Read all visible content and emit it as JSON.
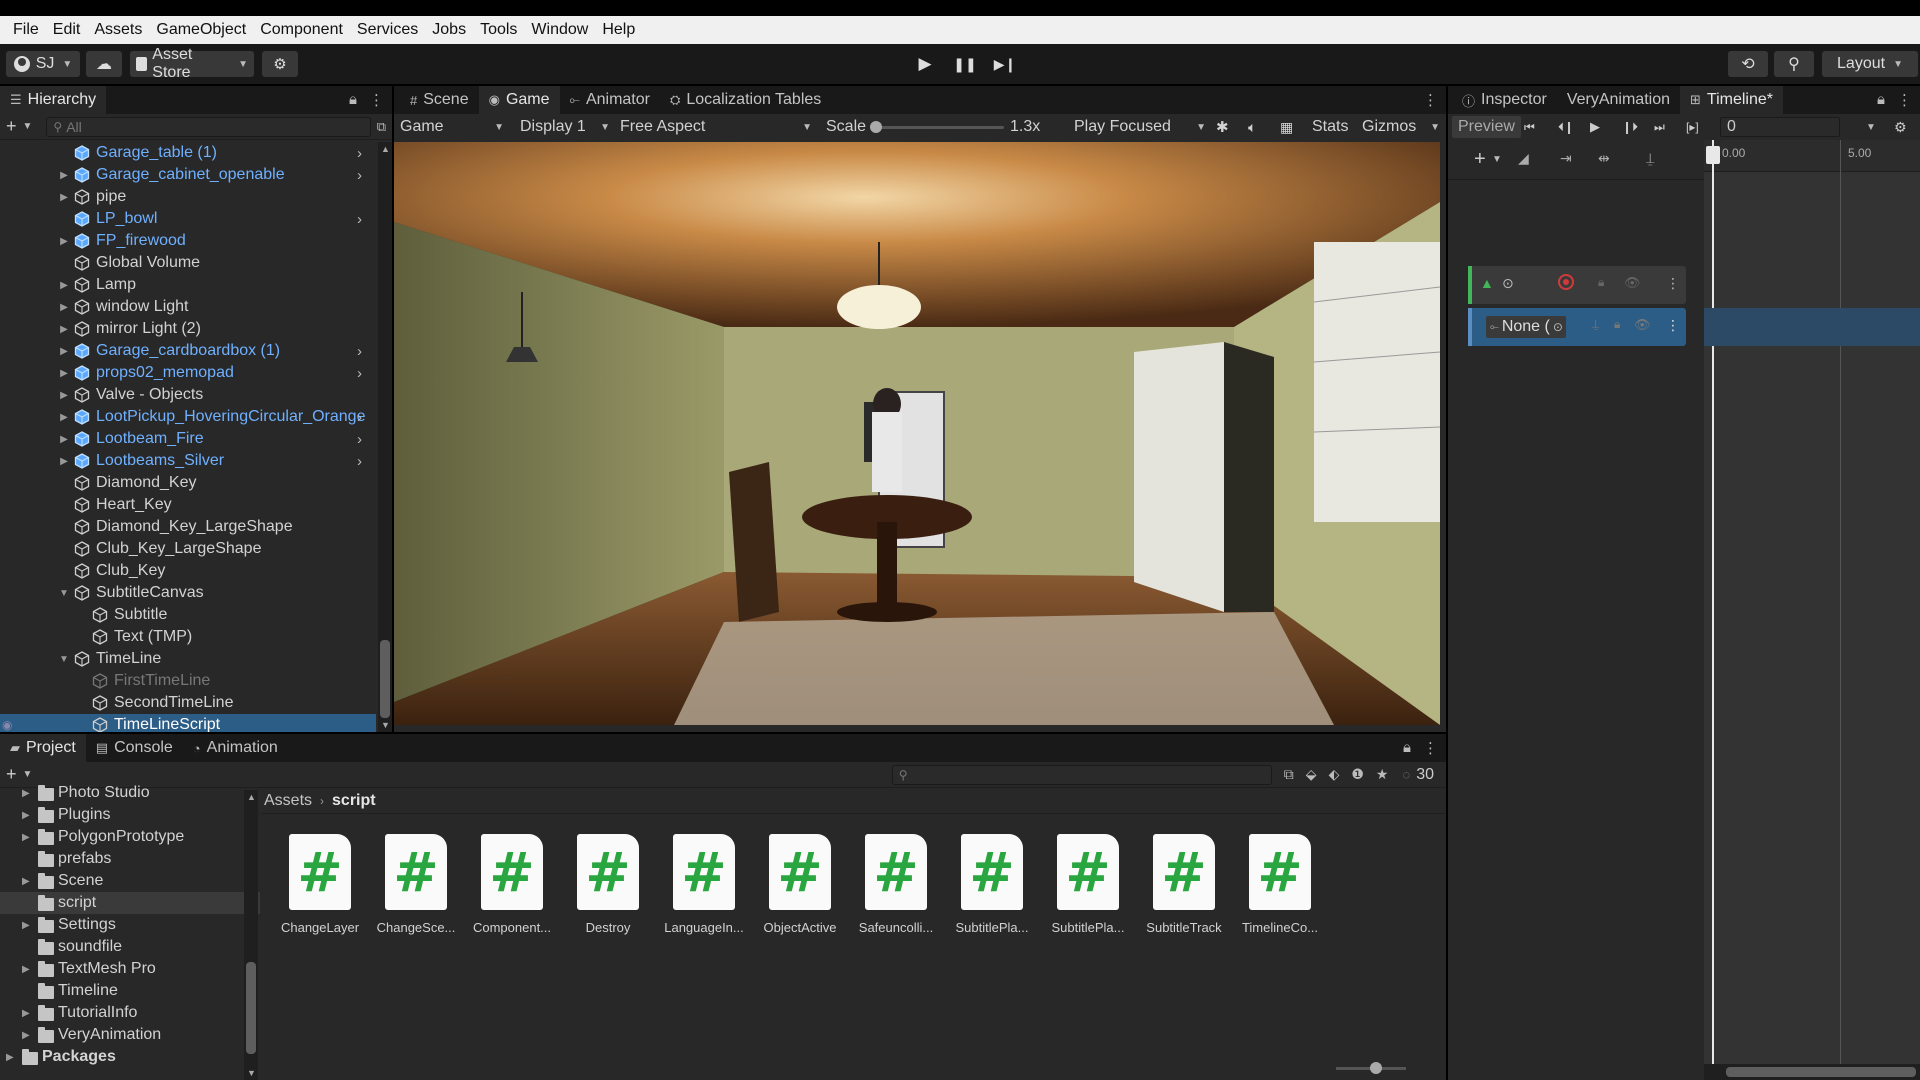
{
  "menu": [
    "File",
    "Edit",
    "Assets",
    "GameObject",
    "Component",
    "Services",
    "Jobs",
    "Tools",
    "Window",
    "Help"
  ],
  "toolbar": {
    "account": "SJ",
    "asset_store": "Asset Store",
    "layout": "Layout"
  },
  "hierarchy": {
    "tab": "Hierarchy",
    "search_placeholder": "All",
    "items": [
      {
        "label": "Garage_table (1)",
        "prefab": true,
        "fold": "none",
        "arrow": true
      },
      {
        "label": "Garage_cabinet_openable",
        "prefab": true,
        "fold": "closed",
        "arrow": true
      },
      {
        "label": "pipe",
        "prefab": false,
        "fold": "closed",
        "arrow": false
      },
      {
        "label": "LP_bowl",
        "prefab": true,
        "fold": "none",
        "arrow": true
      },
      {
        "label": "FP_firewood",
        "prefab": true,
        "fold": "closed",
        "arrow": false
      },
      {
        "label": "Global Volume",
        "prefab": false,
        "fold": "none",
        "arrow": false
      },
      {
        "label": "Lamp",
        "prefab": false,
        "fold": "closed",
        "arrow": false
      },
      {
        "label": "window Light",
        "prefab": false,
        "fold": "closed",
        "arrow": false
      },
      {
        "label": "mirror Light (2)",
        "prefab": false,
        "fold": "closed",
        "arrow": false
      },
      {
        "label": "Garage_cardboardbox (1)",
        "prefab": true,
        "fold": "closed",
        "arrow": true
      },
      {
        "label": "props02_memopad",
        "prefab": true,
        "fold": "closed",
        "arrow": true
      },
      {
        "label": "Valve - Objects",
        "prefab": false,
        "fold": "closed",
        "arrow": false
      },
      {
        "label": "LootPickup_HoveringCircular_Orange",
        "prefab": true,
        "fold": "closed",
        "arrow": true
      },
      {
        "label": "Lootbeam_Fire",
        "prefab": true,
        "fold": "closed",
        "arrow": true
      },
      {
        "label": "Lootbeams_Silver",
        "prefab": true,
        "fold": "closed",
        "arrow": true
      },
      {
        "label": "Diamond_Key",
        "prefab": false,
        "fold": "none",
        "arrow": false
      },
      {
        "label": "Heart_Key",
        "prefab": false,
        "fold": "none",
        "arrow": false
      },
      {
        "label": "Diamond_Key_LargeShape",
        "prefab": false,
        "fold": "none",
        "arrow": false
      },
      {
        "label": "Club_Key_LargeShape",
        "prefab": false,
        "fold": "none",
        "arrow": false
      },
      {
        "label": "Club_Key",
        "prefab": false,
        "fold": "none",
        "arrow": false
      },
      {
        "label": "SubtitleCanvas",
        "prefab": false,
        "fold": "open",
        "arrow": false
      },
      {
        "label": "Subtitle",
        "prefab": false,
        "fold": "none",
        "arrow": false,
        "child": true
      },
      {
        "label": "Text (TMP)",
        "prefab": false,
        "fold": "none",
        "arrow": false,
        "child": true
      },
      {
        "label": "TimeLine",
        "prefab": false,
        "fold": "open",
        "arrow": false
      },
      {
        "label": "FirstTimeLine",
        "prefab": false,
        "fold": "none",
        "arrow": false,
        "child": true,
        "disabled": true
      },
      {
        "label": "SecondTimeLine",
        "prefab": false,
        "fold": "none",
        "arrow": false,
        "child": true
      },
      {
        "label": "TimeLineScript",
        "prefab": false,
        "fold": "none",
        "arrow": false,
        "child": true,
        "selected": true
      }
    ]
  },
  "center_tabs": [
    "Scene",
    "Game",
    "Animator",
    "Localization Tables"
  ],
  "game_bar": {
    "mode": "Game",
    "display": "Display 1",
    "aspect": "Free Aspect",
    "scale_label": "Scale",
    "scale_value": "1.3x",
    "scale_fraction": 0.0,
    "play_mode": "Play Focused",
    "stats": "Stats",
    "gizmos": "Gizmos"
  },
  "bottom_tabs": [
    "Project",
    "Console",
    "Animation"
  ],
  "project": {
    "tree": [
      {
        "label": "Photo Studio",
        "fold": true
      },
      {
        "label": "Plugins",
        "fold": true
      },
      {
        "label": "PolygonPrototype",
        "fold": true
      },
      {
        "label": "prefabs",
        "fold": false
      },
      {
        "label": "Scene",
        "fold": true
      },
      {
        "label": "script",
        "fold": false,
        "selected": true
      },
      {
        "label": "Settings",
        "fold": true
      },
      {
        "label": "soundfile",
        "fold": false
      },
      {
        "label": "TextMesh Pro",
        "fold": true
      },
      {
        "label": "Timeline",
        "fold": false
      },
      {
        "label": "TutorialInfo",
        "fold": true
      },
      {
        "label": "VeryAnimation",
        "fold": true
      }
    ],
    "packages": "Packages",
    "breadcrumb": [
      "Assets",
      "script"
    ],
    "count": "30",
    "assets": [
      "ChangeLayer",
      "ChangeSce...",
      "Component...",
      "Destroy",
      "LanguageIn...",
      "ObjectActive",
      "Safeuncolli...",
      "SubtitlePla...",
      "SubtitlePla...",
      "SubtitleTrack",
      "TimelineCo..."
    ],
    "asset_icon": "#"
  },
  "right_tabs": [
    "Inspector",
    "VeryAnimation",
    "Timeline*"
  ],
  "timeline": {
    "preview": "Preview",
    "frame": "0",
    "ruler": [
      "0.00",
      "5.00"
    ],
    "track_binding": "None (",
    "colors": {
      "track_green": "#43b55a",
      "record": "#d23a3a",
      "playhead": "#ffffff"
    }
  }
}
